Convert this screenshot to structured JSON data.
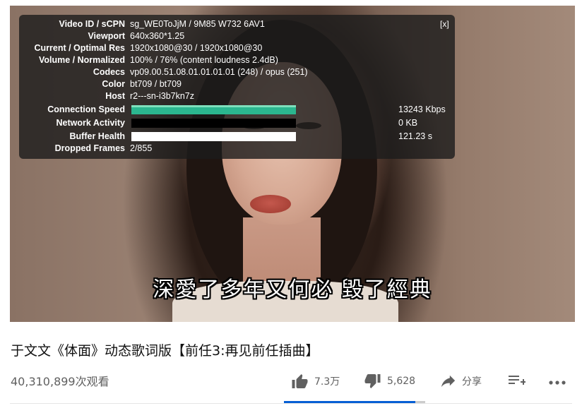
{
  "stats_panel": {
    "close_label": "[x]",
    "rows": [
      {
        "label": "Video ID / sCPN",
        "value": "sg_WE0ToJjM / 9M85 W732 6AV1"
      },
      {
        "label": "Viewport",
        "value": "640x360*1.25"
      },
      {
        "label": "Current / Optimal Res",
        "value": "1920x1080@30 / 1920x1080@30"
      },
      {
        "label": "Volume / Normalized",
        "value": "100% / 76% (content loudness 2.4dB)"
      },
      {
        "label": "Codecs",
        "value": "vp09.00.51.08.01.01.01.01 (248) / opus (251)"
      },
      {
        "label": "Color",
        "value": "bt709 / bt709"
      },
      {
        "label": "Host",
        "value": "r2---sn-i3b7kn7z"
      }
    ],
    "connection_speed": {
      "label": "Connection Speed",
      "value": "13243 Kbps",
      "color": "#2bb68f"
    },
    "network_activity": {
      "label": "Network Activity",
      "value": "0 KB"
    },
    "buffer_health": {
      "label": "Buffer Health",
      "value": "121.23 s"
    },
    "dropped_frames": {
      "label": "Dropped Frames",
      "value": "2/855"
    }
  },
  "subtitle": "深愛了多年又何必 毀了經典",
  "video_title": "于文文《体面》动态歌词版【前任3:再见前任插曲】",
  "view_count": "40,310,899次观看",
  "actions": {
    "like": {
      "icon": "thumbs-up-icon",
      "label": "7.3万"
    },
    "dislike": {
      "icon": "thumbs-down-icon",
      "label": "5,628"
    },
    "share": {
      "icon": "share-icon",
      "label": "分享"
    },
    "save": {
      "icon": "playlist-add-icon"
    },
    "more": {
      "icon": "more-horizontal-icon"
    }
  },
  "like_ratio": 0.93,
  "colors": {
    "accent": "#065fd4",
    "text_secondary": "#606060"
  }
}
